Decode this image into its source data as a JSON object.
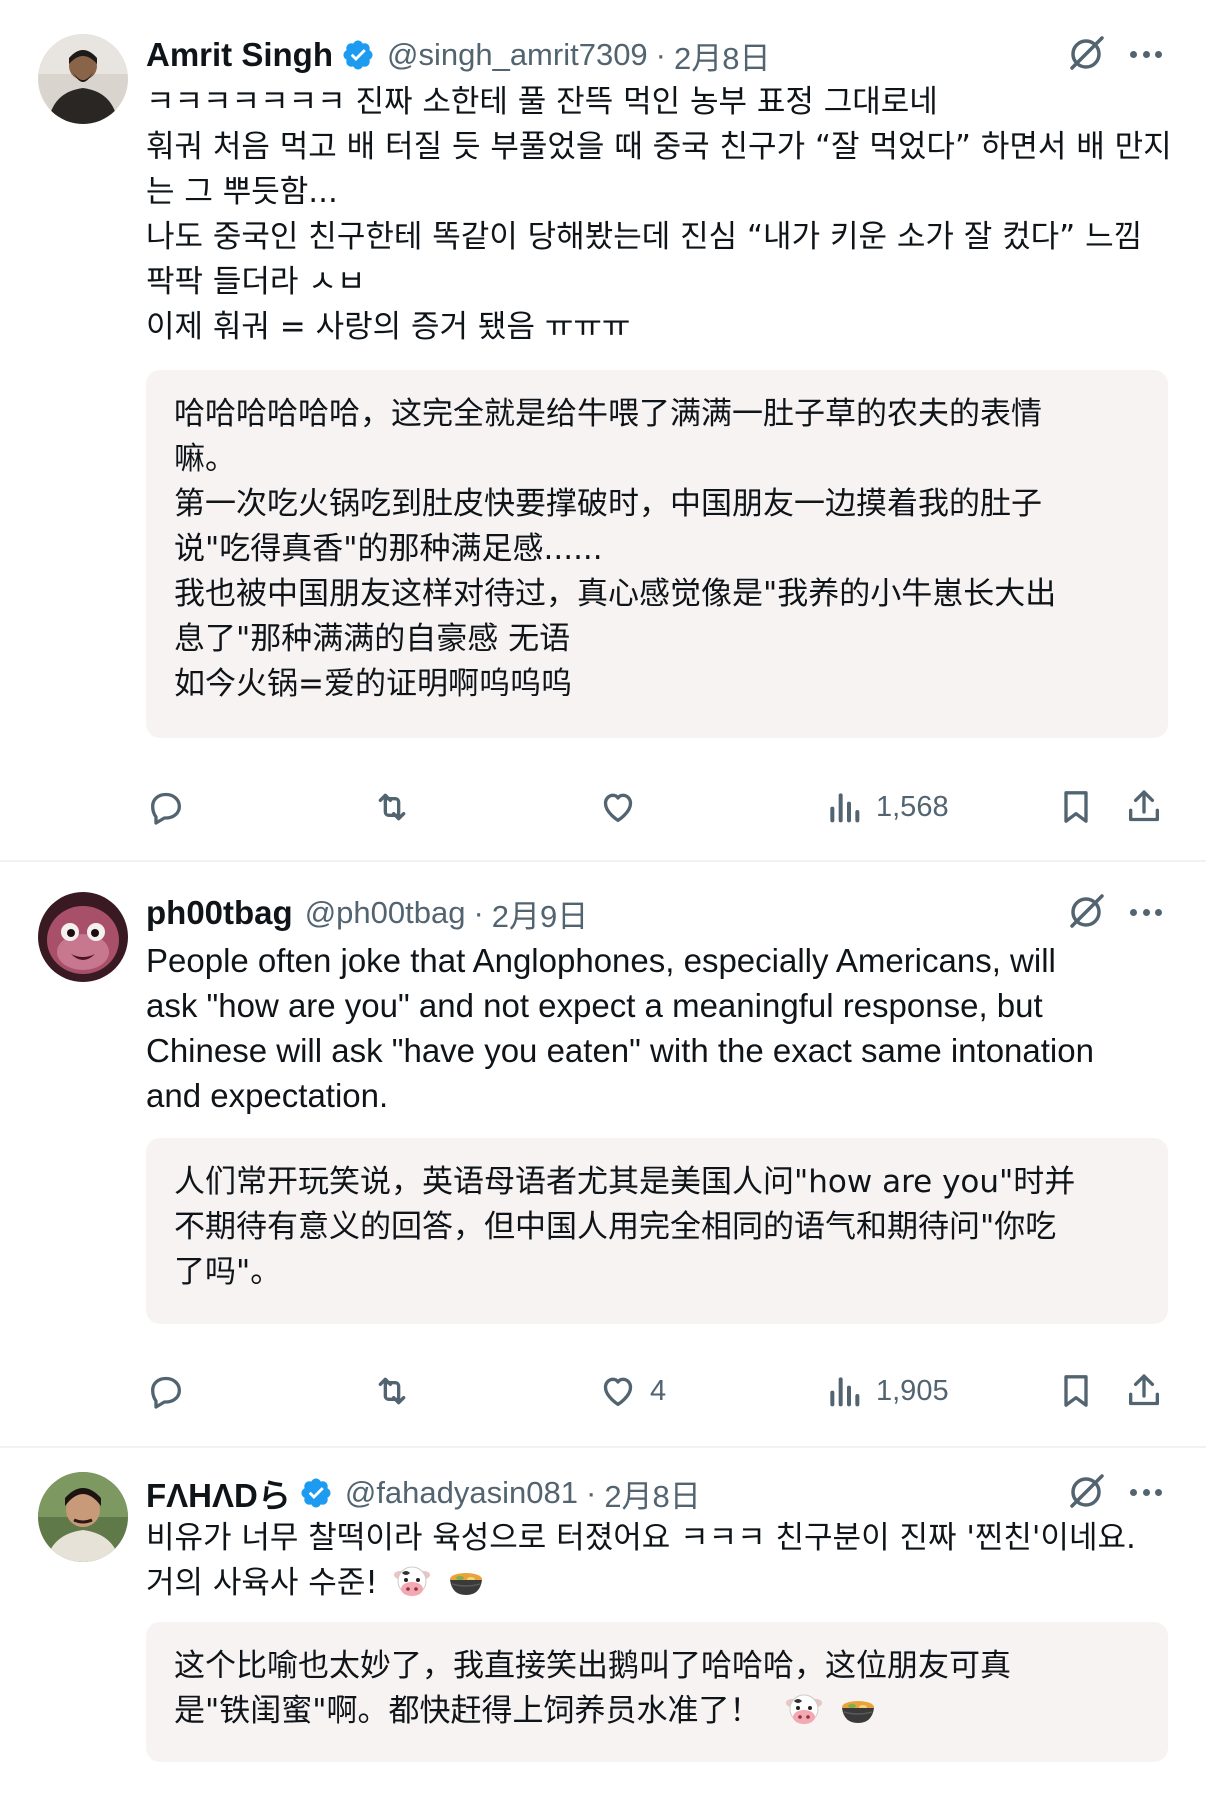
{
  "colors": {
    "verified_blue": "#1d9bf0",
    "secondary_text": "#536471",
    "translation_bg": "#f7f3f3",
    "divider": "#eff3f4"
  },
  "tweets": [
    {
      "name": "Amrit Singh",
      "verified": true,
      "handle": "@singh_amrit7309",
      "date": "2月8日",
      "body": [
        "ㅋㅋㅋㅋㅋㅋㅋ 진짜 소한테 풀 잔뜩 먹인 농부 표정 그대로네",
        "훠궈 처음 먹고 배 터질 듯 부풀었을 때 중국 친구가 “잘 먹었다” 하면서 배 만지",
        "는 그 뿌듯함...",
        "나도 중국인 친구한테 똑같이 당해봤는데 진심 “내가 키운 소가 잘 컸다” 느낌",
        "팍팍 들더라 ㅅㅂ",
        "이제 훠궈 = 사랑의 증거 됐음 ㅠㅠㅠ"
      ],
      "translation": [
        "哈哈哈哈哈哈，这完全就是给牛喂了满满一肚子草的农夫的表情",
        "嘛。",
        "第一次吃火锅吃到肚皮快要撑破时，中国朋友一边摸着我的肚子",
        "说\"吃得真香\"的那种满足感......",
        "我也被中国朋友这样对待过，真心感觉像是\"我养的小牛崽长大出",
        "息了\"那种满满的自豪感 无语",
        "如今火锅=爱的证明啊呜呜呜"
      ],
      "likes": "",
      "views": "1,568"
    },
    {
      "name": "ph00tbag",
      "verified": false,
      "handle": "@ph00tbag",
      "date": "2月9日",
      "body": [
        "People often joke that Anglophones, especially Americans, will",
        "ask \"how are you\" and not expect a meaningful response, but",
        "Chinese will ask \"have you eaten\" with the exact same intonation",
        "and expectation."
      ],
      "translation": [
        "人们常开玩笑说，英语母语者尤其是美国人问\"how are you\"时并",
        "不期待有意义的回答，但中国人用完全相同的语气和期待问\"你吃",
        "了吗\"。"
      ],
      "likes": "4",
      "views": "1,905"
    },
    {
      "name": "FΛHΛDら",
      "verified": true,
      "handle": "@fahadyasin081",
      "date": "2月8日",
      "body": [
        "비유가 너무 찰떡이라 육성으로 터졌어요 ㅋㅋㅋ 친구분이 진짜 '찐친'이네요.",
        "거의 사육사 수준!"
      ],
      "translation": [
        "这个比喻也太妙了，我直接笑出鹅叫了哈哈哈，这位朋友可真",
        "是\"铁闺蜜\"啊。都快赶得上饲养员水准了！"
      ],
      "emojis": [
        "cow-face-emoji",
        "hotpot-bowl-emoji"
      ]
    }
  ]
}
